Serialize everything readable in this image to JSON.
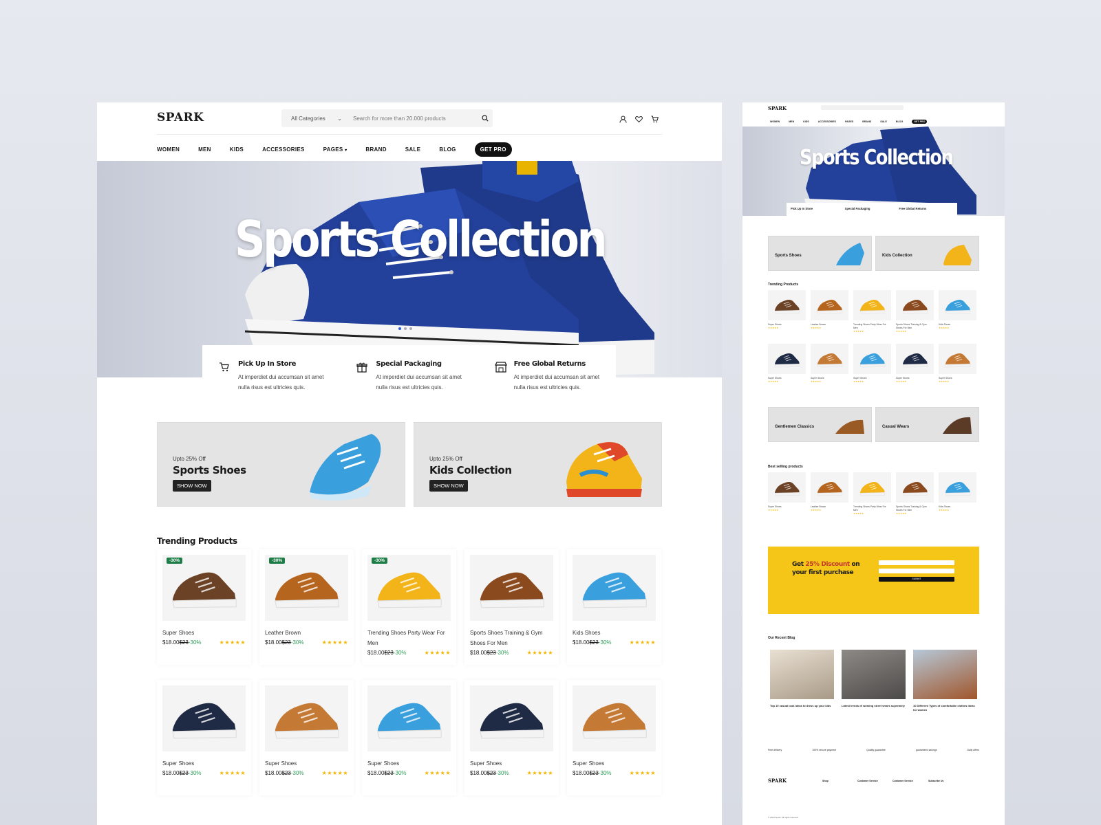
{
  "brand": "SPARK",
  "search": {
    "category": "All Categories",
    "placeholder": "Search for more than 20.000 products"
  },
  "nav": {
    "items": [
      "WOMEN",
      "MEN",
      "KIDS",
      "ACCESSORIES",
      "PAGES",
      "BRAND",
      "SALE",
      "BLOG"
    ],
    "cta": "GET PRO"
  },
  "hero": {
    "title": "Sports Collection",
    "slides": 3,
    "active_slide": 1
  },
  "features": [
    {
      "title": "Pick Up In Store",
      "desc": "At imperdiet dui accumsan sit amet nulla risus est ultricies quis.",
      "icon": "cart-icon"
    },
    {
      "title": "Special Packaging",
      "desc": "At imperdiet dui accumsan sit amet nulla risus est ultricies quis.",
      "icon": "gift-icon"
    },
    {
      "title": "Free Global Returns",
      "desc": "At imperdiet dui accumsan sit amet nulla risus est ultricies quis.",
      "icon": "store-icon"
    }
  ],
  "promos": [
    {
      "sub": "Upto 25% Off",
      "title": "Sports Shoes",
      "button": "SHOW NOW"
    },
    {
      "sub": "Upto 25% Off",
      "title": "Kids Collection",
      "button": "SHOW NOW"
    }
  ],
  "trending": {
    "title": "Trending Products",
    "products": [
      {
        "name": "Super Shoes",
        "price": "$18.00",
        "old": "$23",
        "off": "-30%",
        "badge": "-30%",
        "color": "#6b4226"
      },
      {
        "name": "Leather Brown",
        "price": "$18.00",
        "old": "$23",
        "off": "-30%",
        "badge": "-30%",
        "color": "#b5651d"
      },
      {
        "name": "Trending Shoes Party Wear For Men",
        "price": "$18.00",
        "old": "$23",
        "off": "-30%",
        "badge": "-30%",
        "color": "#f2b418"
      },
      {
        "name": "Sports Shoes Training & Gym Shoes For Men",
        "price": "$18.00",
        "old": "$23",
        "off": "-30%",
        "badge": "",
        "color": "#8b4a1e"
      },
      {
        "name": "Kids Shoes",
        "price": "$18.00",
        "old": "$23",
        "off": "-30%",
        "badge": "",
        "color": "#3aa0dd"
      },
      {
        "name": "Super Shoes",
        "price": "$18.00",
        "old": "$23",
        "off": "-30%",
        "badge": "",
        "color": "#1f2a44"
      },
      {
        "name": "Super Shoes",
        "price": "$18.00",
        "old": "$23",
        "off": "-30%",
        "badge": "",
        "color": "#c47a35"
      },
      {
        "name": "Super Shoes",
        "price": "$18.00",
        "old": "$23",
        "off": "-30%",
        "badge": "",
        "color": "#3aa0dd"
      },
      {
        "name": "Super Shoes",
        "price": "$18.00",
        "old": "$23",
        "off": "-30%",
        "badge": "",
        "color": "#1f2a44"
      },
      {
        "name": "Super Shoes",
        "price": "$18.00",
        "old": "$23",
        "off": "-30%",
        "badge": "",
        "color": "#c47a35"
      }
    ]
  },
  "stars": "★★★★★",
  "mini": {
    "brand": "SPARK",
    "hero_title": "Sports Collection",
    "nav": [
      "WOMEN",
      "MEN",
      "KIDS",
      "ACCESSORIES",
      "PAGES",
      "BRAND",
      "SALE",
      "BLOG",
      "GET PRO"
    ],
    "features": [
      "Pick Up In Store",
      "Special Packaging",
      "Free Global Returns"
    ],
    "promos_top": [
      {
        "title": "Sports Shoes",
        "color": "#3aa0dd"
      },
      {
        "title": "Kids Collection",
        "color": "#f2b418"
      }
    ],
    "trending_title": "Trending Products",
    "promos_mid": [
      {
        "title": "Gentlemen Classics",
        "color": "#9a5a24"
      },
      {
        "title": "Casual Wears",
        "color": "#5b3a26"
      }
    ],
    "best_title": "Best selling products",
    "discount": {
      "pre": "Get ",
      "hl": "25% Discount",
      "post": " on your first purchase",
      "submit": "SUBMIT"
    },
    "blog_title": "Our Recent Blog",
    "blogs": [
      "Top 10 casual look ideas to dress up your kids",
      "Latest trends of wearing street wears supremely",
      "10 Different Types of comfortable clothes ideas for women"
    ],
    "footer_feats": [
      "Free delivery",
      "100% secure payment",
      "Quality guarantee",
      "guaranteed savings",
      "Daily offers"
    ],
    "footer_cols": [
      "Shop",
      "Customer Service",
      "Customer Service",
      "Subscribe Us"
    ],
    "copyright": "© 2024 Spark. All rights reserved."
  }
}
